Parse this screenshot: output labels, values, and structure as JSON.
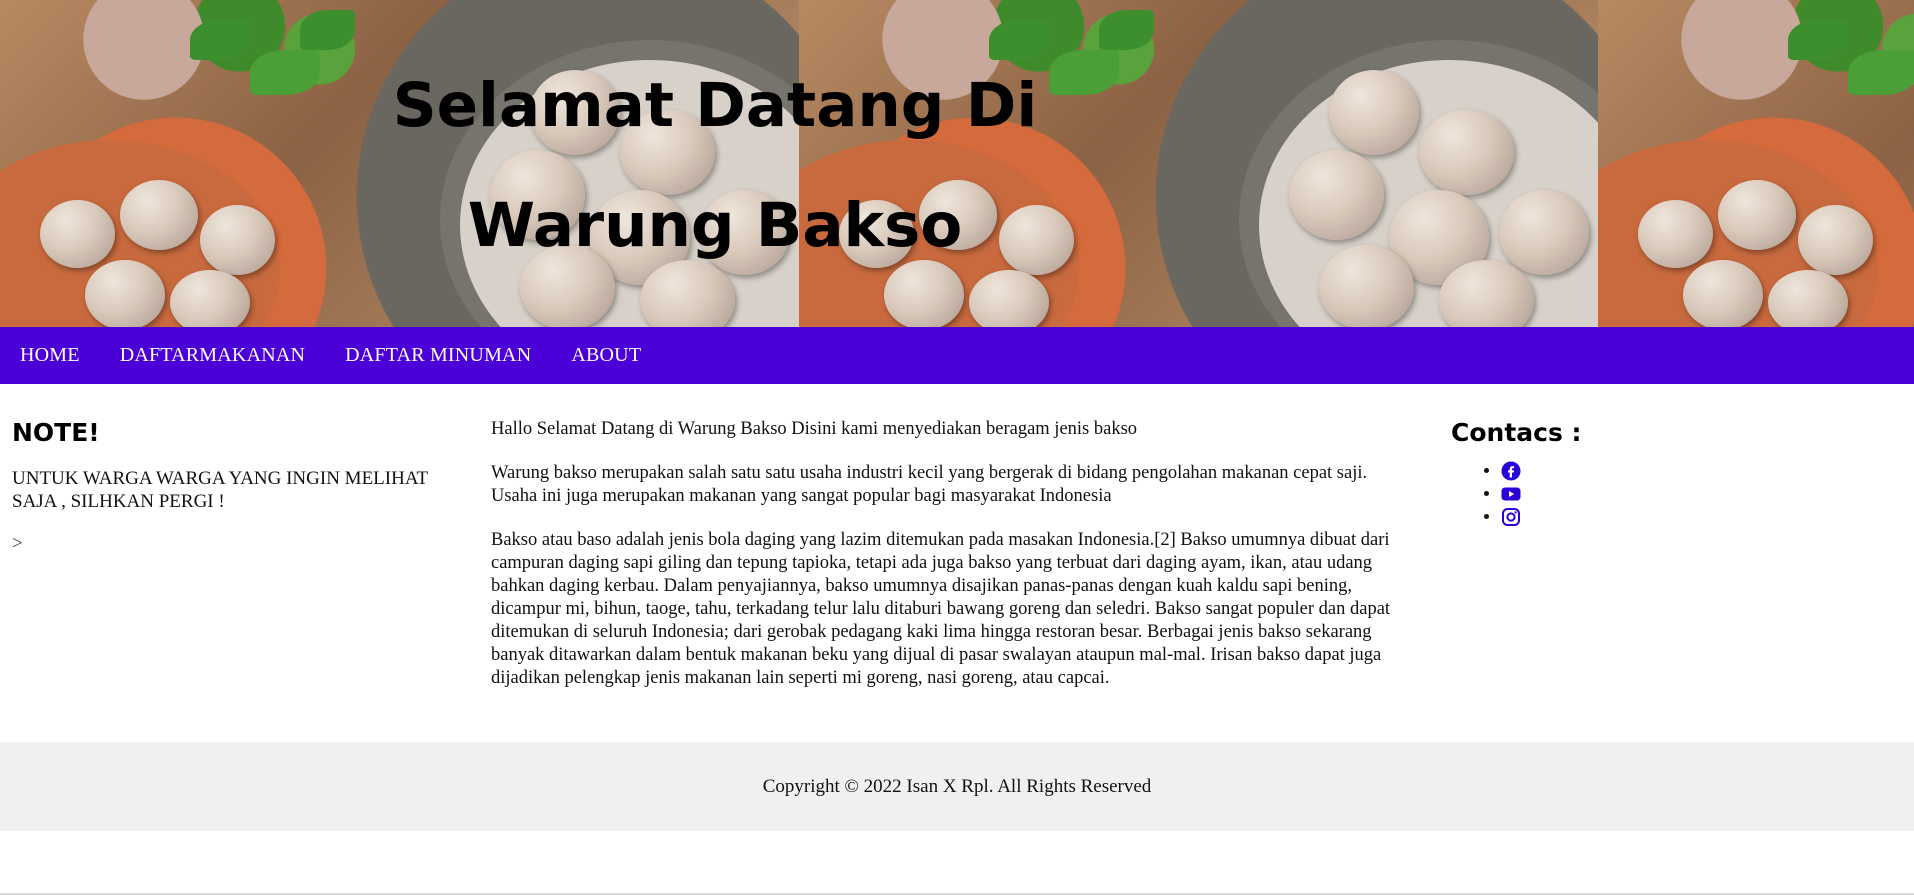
{
  "header": {
    "title_line1": "Selamat Datang Di",
    "title_line2": "Warung Bakso"
  },
  "nav": {
    "items": [
      "HOME",
      "DAFTARMAKANAN",
      "DAFTAR MINUMAN",
      "ABOUT"
    ]
  },
  "note": {
    "heading": "NOTE!",
    "text": "UNTUK WARGA WARGA YANG INGIN MELIHAT SAJA , SILHKAN PERGI !",
    "marker": ">"
  },
  "main": {
    "paragraphs": [
      "Hallo Selamat Datang di Warung Bakso Disini kami menyediakan beragam jenis bakso",
      "Warung bakso merupakan salah satu satu usaha industri kecil yang bergerak di bidang pengolahan makanan cepat saji. Usaha ini juga merupakan makanan yang sangat popular bagi masyarakat Indonesia",
      "Bakso atau baso adalah jenis bola daging yang lazim ditemukan pada masakan Indonesia.[2] Bakso umumnya dibuat dari campuran daging sapi giling dan tepung tapioka, tetapi ada juga bakso yang terbuat dari daging ayam, ikan, atau udang bahkan daging kerbau. Dalam penyajiannya, bakso umumnya disajikan panas-panas dengan kuah kaldu sapi bening, dicampur mi, bihun, taoge, tahu, terkadang telur lalu ditaburi bawang goreng dan seledri. Bakso sangat populer dan dapat ditemukan di seluruh Indonesia; dari gerobak pedagang kaki lima hingga restoran besar. Berbagai jenis bakso sekarang banyak ditawarkan dalam bentuk makanan beku yang dijual di pasar swalayan ataupun mal-mal. Irisan bakso dapat juga dijadikan pelengkap jenis makanan lain seperti mi goreng, nasi goreng, atau capcai."
    ]
  },
  "contacts": {
    "heading": "Contacs :",
    "icons": [
      "facebook-icon",
      "youtube-icon",
      "instagram-icon"
    ],
    "icon_color": "#2b00d8"
  },
  "footer": {
    "copyright": "Copyright © 2022 Isan X Rpl. All Rights Reserved"
  },
  "colors": {
    "nav_bg": "#4b00d8",
    "footer_bg": "#f0f0f0"
  }
}
